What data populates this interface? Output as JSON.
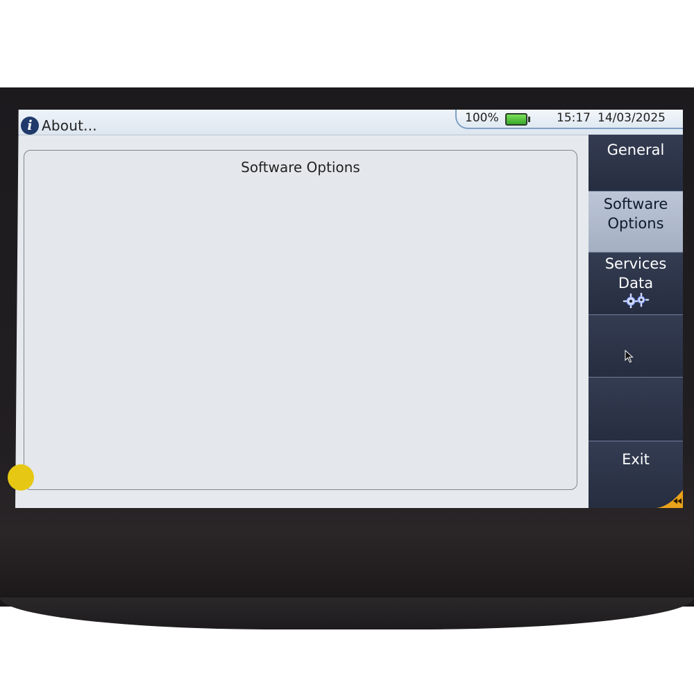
{
  "window": {
    "title": "About..."
  },
  "status": {
    "battery_percent": "100%",
    "time": "15:17",
    "date": "14/03/2025"
  },
  "panel": {
    "title": "Software Options"
  },
  "softkeys": {
    "general": "General",
    "software_options_line1": "Software",
    "software_options_line2": "Options",
    "services_data_line1": "Services",
    "services_data_line2": "Data",
    "exit": "Exit"
  },
  "icons": {
    "info": "info-icon",
    "battery": "battery-icon",
    "services": "gears-icon",
    "back": "rewind-icon",
    "cursor": "mouse-pointer-icon"
  },
  "colors": {
    "softkey_bg": "#242a38",
    "softkey_active_bg": "#b0bbcd",
    "screen_bg": "#e6eaee",
    "battery_green": "#39a82a",
    "back_corner": "#e9a21a"
  }
}
